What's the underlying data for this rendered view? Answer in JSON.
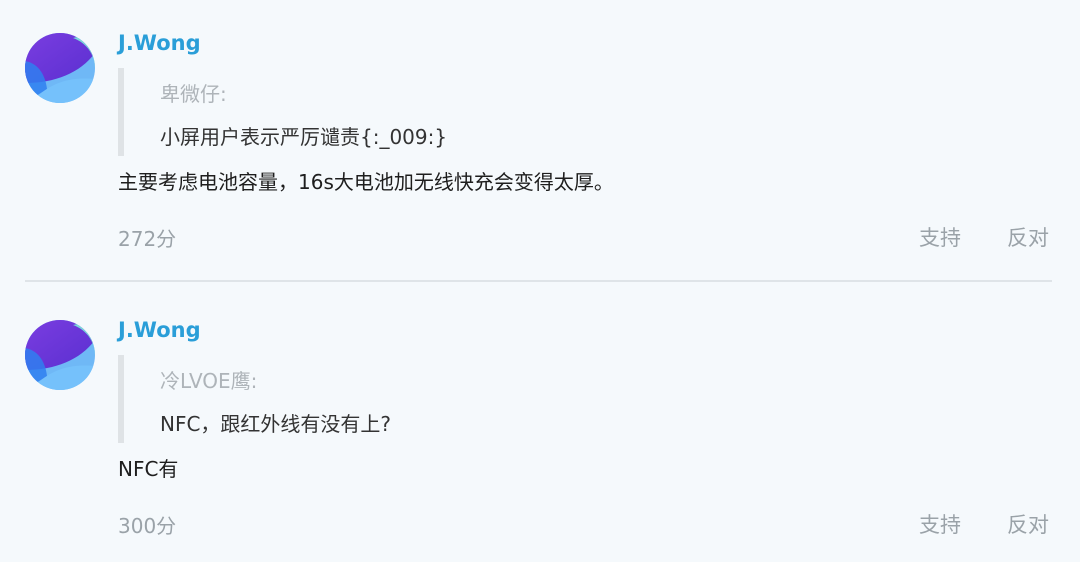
{
  "comments": [
    {
      "username": "J.Wong",
      "avatar_icon": "gradient-avatar-icon",
      "quote_author": "卑微仔:",
      "quote_text": "小屏用户表示严厉谴责{:_009:}",
      "reply_text": "主要考虑电池容量，16s大电池加无线快充会变得太厚。",
      "score": "272分",
      "support_label": "支持",
      "oppose_label": "反对"
    },
    {
      "username": "J.Wong",
      "avatar_icon": "gradient-avatar-icon",
      "quote_author": "冷LVOE鹰:",
      "quote_text": "NFC，跟红外线有没有上?",
      "reply_text": "NFC有",
      "score": "300分",
      "support_label": "支持",
      "oppose_label": "反对"
    }
  ],
  "colors": {
    "background": "#f5f9fc",
    "username": "#2a9ed8",
    "muted": "#9aa2a8",
    "quote_bar": "#dfe3e6",
    "divider": "#dfe4e8"
  }
}
